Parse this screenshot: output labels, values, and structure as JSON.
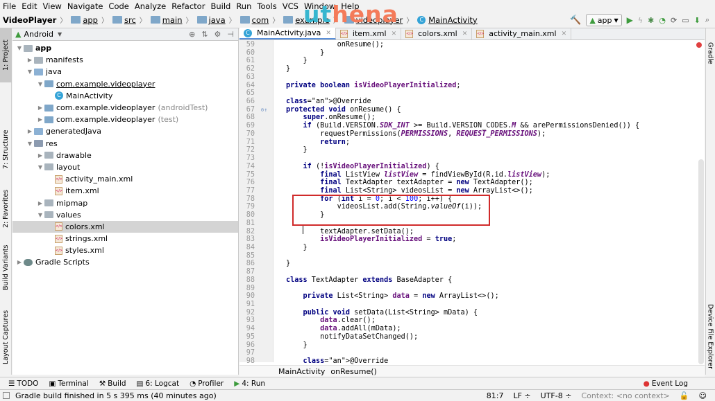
{
  "menu": [
    "File",
    "Edit",
    "View",
    "Navigate",
    "Code",
    "Analyze",
    "Refactor",
    "Build",
    "Run",
    "Tools",
    "VCS",
    "Window",
    "Help"
  ],
  "breadcrumb": [
    "VideoPlayer",
    "app",
    "src",
    "main",
    "java",
    "com",
    "example",
    "videoplayer",
    "MainActivity"
  ],
  "logo": {
    "part1": "ut",
    "part2": "hena"
  },
  "toolbar": {
    "run_config": "app"
  },
  "left_tabs": [
    "1: Project",
    "7: Structure",
    "2: Favorites",
    "Build Variants",
    "Layout Captures"
  ],
  "right_tabs": [
    "Gradle",
    "Device File Explorer"
  ],
  "project": {
    "view": "Android"
  },
  "tree": [
    {
      "label": "app",
      "indent": 0,
      "bold": true,
      "icon": "folder"
    },
    {
      "label": "manifests",
      "indent": 1,
      "icon": "folder"
    },
    {
      "label": "java",
      "indent": 1,
      "icon": "folder-blue"
    },
    {
      "label": "com.example.videoplayer",
      "indent": 2,
      "icon": "package",
      "underline": true
    },
    {
      "label": "MainActivity",
      "indent": 3,
      "icon": "class"
    },
    {
      "label": "com.example.videoplayer",
      "suffix": "(androidTest)",
      "indent": 2,
      "icon": "package"
    },
    {
      "label": "com.example.videoplayer",
      "suffix": "(test)",
      "indent": 2,
      "icon": "package"
    },
    {
      "label": "generatedJava",
      "indent": 1,
      "icon": "folder-blue"
    },
    {
      "label": "res",
      "indent": 1,
      "icon": "res"
    },
    {
      "label": "drawable",
      "indent": 2,
      "icon": "folder"
    },
    {
      "label": "layout",
      "indent": 2,
      "icon": "folder"
    },
    {
      "label": "activity_main.xml",
      "indent": 3,
      "icon": "xml"
    },
    {
      "label": "item.xml",
      "indent": 3,
      "icon": "xml"
    },
    {
      "label": "mipmap",
      "indent": 2,
      "icon": "folder"
    },
    {
      "label": "values",
      "indent": 2,
      "icon": "folder"
    },
    {
      "label": "colors.xml",
      "indent": 3,
      "icon": "xml",
      "selected": true
    },
    {
      "label": "strings.xml",
      "indent": 3,
      "icon": "xml"
    },
    {
      "label": "styles.xml",
      "indent": 3,
      "icon": "xml"
    },
    {
      "label": "Gradle Scripts",
      "indent": 0,
      "icon": "gradle"
    }
  ],
  "editor_tabs": [
    "MainActivity.java",
    "item.xml",
    "colors.xml",
    "activity_main.xml"
  ],
  "code": [
    {
      "n": "59",
      "t": "            onResume();"
    },
    {
      "n": "60",
      "t": "        }"
    },
    {
      "n": "61",
      "t": "    }"
    },
    {
      "n": "62",
      "t": "}"
    },
    {
      "n": "63",
      "t": ""
    },
    {
      "n": "64",
      "t": "private boolean isVideoPlayerInitialized;"
    },
    {
      "n": "65",
      "t": ""
    },
    {
      "n": "66",
      "t": "@Override"
    },
    {
      "n": "67",
      "t": "protected void onResume() {"
    },
    {
      "n": "68",
      "t": "    super.onResume();"
    },
    {
      "n": "69",
      "t": "    if (Build.VERSION.SDK_INT >= Build.VERSION_CODES.M && arePermissionsDenied()) {"
    },
    {
      "n": "70",
      "t": "        requestPermissions(PERMISSIONS, REQUEST_PERMISSIONS);"
    },
    {
      "n": "71",
      "t": "        return;"
    },
    {
      "n": "72",
      "t": "    }"
    },
    {
      "n": "73",
      "t": ""
    },
    {
      "n": "74",
      "t": "    if (!isVideoPlayerInitialized) {"
    },
    {
      "n": "75",
      "t": "        final ListView listView = findViewById(R.id.listView);"
    },
    {
      "n": "76",
      "t": "        final TextAdapter textAdapter = new TextAdapter();"
    },
    {
      "n": "77",
      "t": "        final List<String> videosList = new ArrayList<>();"
    },
    {
      "n": "78",
      "t": "        for (int i = 0; i < 100; i++) {"
    },
    {
      "n": "79",
      "t": "            videosList.add(String.valueOf(i));"
    },
    {
      "n": "80",
      "t": "        }"
    },
    {
      "n": "81",
      "t": ""
    },
    {
      "n": "82",
      "t": "        textAdapter.setData();"
    },
    {
      "n": "83",
      "t": "        isVideoPlayerInitialized = true;"
    },
    {
      "n": "84",
      "t": "    }"
    },
    {
      "n": "85",
      "t": ""
    },
    {
      "n": "86",
      "t": "}"
    },
    {
      "n": "87",
      "t": ""
    },
    {
      "n": "88",
      "t": "class TextAdapter extends BaseAdapter {"
    },
    {
      "n": "89",
      "t": ""
    },
    {
      "n": "90",
      "t": "    private List<String> data = new ArrayList<>();"
    },
    {
      "n": "91",
      "t": ""
    },
    {
      "n": "92",
      "t": "    public void setData(List<String> mData) {"
    },
    {
      "n": "93",
      "t": "        data.clear();"
    },
    {
      "n": "94",
      "t": "        data.addAll(mData);"
    },
    {
      "n": "95",
      "t": "        notifyDataSetChanged();"
    },
    {
      "n": "96",
      "t": "    }"
    },
    {
      "n": "97",
      "t": ""
    },
    {
      "n": "98",
      "t": "    @Override"
    }
  ],
  "editor_breadcrumb": [
    "MainActivity",
    "onResume()"
  ],
  "bottom_tabs": [
    "TODO",
    "Terminal",
    "Build",
    "6: Logcat",
    "Profiler",
    "4: Run"
  ],
  "event_log": "Event Log",
  "status": {
    "message": "Gradle build finished in 5 s 395 ms (40 minutes ago)",
    "position": "81:7",
    "line_sep": "LF ÷",
    "encoding": "UTF-8 ÷",
    "context": "Context: <no context>"
  }
}
